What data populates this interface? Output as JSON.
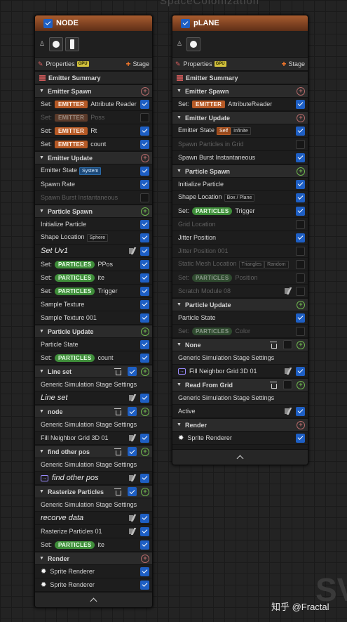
{
  "canvas_title": "SpaceColonization",
  "watermark": "知乎 @Fractal",
  "watermark_bg": "SV",
  "colors": {
    "emitter_header": "#a85c2f",
    "emitter_ns": "#b65a26",
    "particles_ns": "#3f8e3a",
    "checkbox": "#1e5fc4"
  },
  "common": {
    "properties": "Properties",
    "gpu": "GPU",
    "stage": "Stage",
    "emitter_summary": "Emitter Summary",
    "set": "Set:",
    "emitter": "EMITTER",
    "particles": "PARTICLES",
    "generic_sim": "Generic Simulation Stage Settings"
  },
  "node": {
    "title": "NODE",
    "emitter_spawn": {
      "label": "Emitter Spawn",
      "rows": [
        {
          "text": "Attribute Reader",
          "enabled": true
        },
        {
          "text": "Poss",
          "enabled": false
        },
        {
          "text": "Rt",
          "enabled": true
        },
        {
          "text": "count",
          "enabled": true
        }
      ]
    },
    "emitter_update": {
      "label": "Emitter Update",
      "emitter_state": "Emitter State",
      "system_tag": "System",
      "spawn_rate": "Spawn Rate",
      "spawn_burst": "Spawn Burst Instantaneous"
    },
    "particle_spawn": {
      "label": "Particle Spawn",
      "initialize": "Initialize Particle",
      "shape_location": "Shape Location",
      "sphere_tag": "Sphere",
      "set_uv": "Set Uv1",
      "ppos": "PPos",
      "ite": "ite",
      "trigger": "Trigger",
      "sample_texture": "Sample Texture",
      "sample_texture_001": "Sample Texture 001"
    },
    "particle_update": {
      "label": "Particle Update",
      "particle_state": "Particle State",
      "count": "count"
    },
    "line_set": {
      "label": "Line set",
      "row": "Line set"
    },
    "node_stage": {
      "label": "node",
      "row": "Fill Neighbor Grid 3D 01"
    },
    "find_other_pos": {
      "label": "find other pos",
      "row": "find other pos"
    },
    "rasterize": {
      "label": "Rasterize Particles",
      "recorve": "recorve data",
      "rasterize_01": "Rasterize Particles 01",
      "ite": "ite"
    },
    "render": {
      "label": "Render",
      "r1": "Sprite Renderer",
      "r2": "Sprite Renderer"
    }
  },
  "plane": {
    "title": "pLANE",
    "emitter_spawn": {
      "label": "Emitter Spawn",
      "row": "AttributeReader"
    },
    "emitter_update": {
      "label": "Emitter Update",
      "emitter_state": "Emitter State",
      "self_tag": "Self",
      "infinite_tag": "Infinite",
      "spawn_particles_grid": "Spawn Particles in Grid",
      "spawn_burst": "Spawn Burst Instantaneous"
    },
    "particle_spawn": {
      "label": "Particle Spawn",
      "initialize": "Initialize Particle",
      "shape_location": "Shape Location",
      "box_tag": "Box / Plane",
      "trigger": "Trigger",
      "grid_location": "Grid Location",
      "jitter": "Jitter Position",
      "jitter_001": "Jitter Position 001",
      "static_mesh": "Static Mesh Location",
      "triangles_tag": "Triangles",
      "random_tag": "Random",
      "position": "Position",
      "scratch": "Scratch Module 08"
    },
    "particle_update": {
      "label": "Particle Update",
      "particle_state": "Particle State",
      "color": "Color"
    },
    "none_stage": {
      "label": "None",
      "row": "Fill Neighbor Grid 3D 01"
    },
    "read_grid": {
      "label": "Read From Grid",
      "active": "Active"
    },
    "render": {
      "label": "Render",
      "r1": "Sprite Renderer"
    }
  }
}
